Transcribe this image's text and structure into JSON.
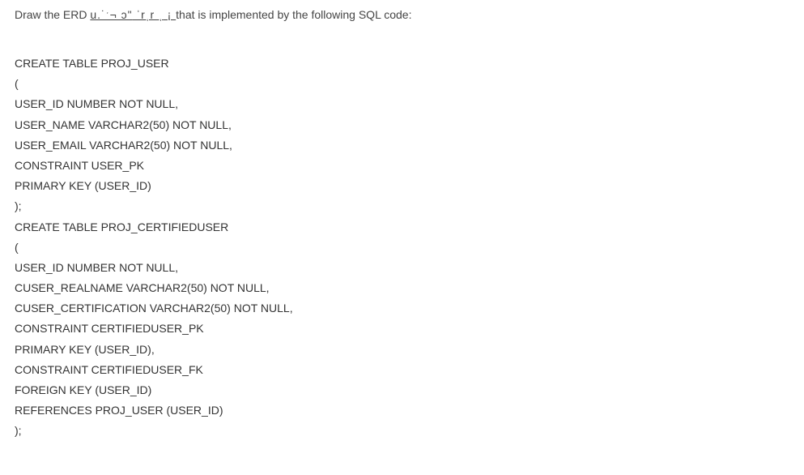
{
  "question": {
    "part1": "Draw the ERD ",
    "garbled1": "u.˙ˑ¬ ɔ\"",
    "garbled2": "  ˈrˌr  ˌ",
    "garbled3": "  ¡ ",
    "part2": "that is implemented by the following SQL code:"
  },
  "code": {
    "lines": [
      "CREATE TABLE PROJ_USER",
      "(",
      "USER_ID NUMBER NOT NULL,",
      "USER_NAME VARCHAR2(50) NOT NULL,",
      "USER_EMAIL VARCHAR2(50) NOT NULL,",
      "CONSTRAINT USER_PK",
      "PRIMARY KEY (USER_ID)",
      ");",
      "CREATE TABLE PROJ_CERTIFIEDUSER",
      "(",
      "USER_ID NUMBER NOT NULL,",
      "CUSER_REALNAME VARCHAR2(50) NOT NULL,",
      "CUSER_CERTIFICATION VARCHAR2(50) NOT NULL,",
      "CONSTRAINT CERTIFIEDUSER_PK",
      "PRIMARY KEY (USER_ID),",
      "CONSTRAINT CERTIFIEDUSER_FK",
      "FOREIGN KEY (USER_ID)",
      "REFERENCES PROJ_USER (USER_ID)",
      ");"
    ]
  }
}
